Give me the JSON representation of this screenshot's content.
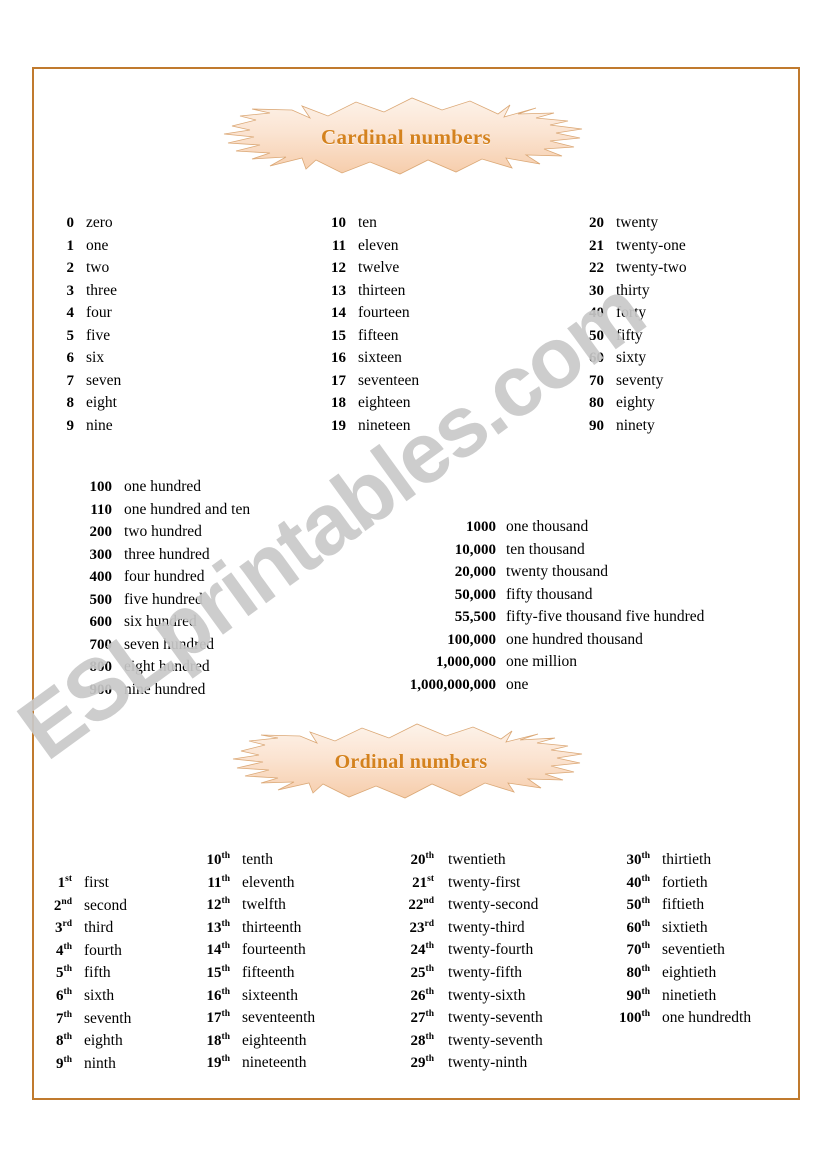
{
  "page": {
    "border_color": "#c07a2e",
    "background": "#ffffff",
    "watermark_text": "ESLprintables.com",
    "watermark_color": "#c9c9c9"
  },
  "banners": {
    "cardinal_title": "Cardinal numbers",
    "ordinal_title": "Ordinal numbers",
    "title_color": "#d4821e",
    "fill_light": "#fdf0e6",
    "fill_dark": "#f7cfae",
    "stroke": "#d9a273"
  },
  "cardinal": {
    "columns": [
      {
        "rows": [
          {
            "num": "0",
            "word": "zero"
          },
          {
            "num": "1",
            "word": "one"
          },
          {
            "num": "2",
            "word": "two"
          },
          {
            "num": "3",
            "word": "three"
          },
          {
            "num": "4",
            "word": "four"
          },
          {
            "num": "5",
            "word": "five"
          },
          {
            "num": "6",
            "word": "six"
          },
          {
            "num": "7",
            "word": "seven"
          },
          {
            "num": "8",
            "word": "eight"
          },
          {
            "num": "9",
            "word": "nine"
          }
        ]
      },
      {
        "rows": [
          {
            "num": "10",
            "word": "ten"
          },
          {
            "num": "11",
            "word": "eleven"
          },
          {
            "num": "12",
            "word": "twelve"
          },
          {
            "num": "13",
            "word": "thirteen"
          },
          {
            "num": "14",
            "word": "fourteen"
          },
          {
            "num": "15",
            "word": "fifteen"
          },
          {
            "num": "16",
            "word": "sixteen"
          },
          {
            "num": "17",
            "word": "seventeen"
          },
          {
            "num": "18",
            "word": "eighteen"
          },
          {
            "num": "19",
            "word": "nineteen"
          }
        ]
      },
      {
        "rows": [
          {
            "num": "20",
            "word": "twenty"
          },
          {
            "num": "21",
            "word": "twenty-one"
          },
          {
            "num": "22",
            "word": "twenty-two"
          },
          {
            "num": "30",
            "word": "thirty"
          },
          {
            "num": "40",
            "word": "forty"
          },
          {
            "num": "50",
            "word": "fifty"
          },
          {
            "num": "60",
            "word": "sixty"
          },
          {
            "num": "70",
            "word": "seventy"
          },
          {
            "num": "80",
            "word": "eighty"
          },
          {
            "num": "90",
            "word": "ninety"
          }
        ]
      }
    ]
  },
  "hundreds": {
    "rows": [
      {
        "num": "100",
        "word": "one hundred"
      },
      {
        "num": "110",
        "word": "one hundred and ten"
      },
      {
        "num": "200",
        "word": "two hundred"
      },
      {
        "num": "300",
        "word": "three hundred"
      },
      {
        "num": "400",
        "word": "four hundred"
      },
      {
        "num": "500",
        "word": "five hundred"
      },
      {
        "num": "600",
        "word": "six hundred"
      },
      {
        "num": "700",
        "word": "seven hundred"
      },
      {
        "num": "800",
        "word": "eight hundred"
      },
      {
        "num": "900",
        "word": "nine hundred"
      }
    ]
  },
  "thousands": {
    "rows": [
      {
        "num": "1000",
        "word": "one thousand"
      },
      {
        "num": "10,000",
        "word": "ten thousand"
      },
      {
        "num": "20,000",
        "word": "twenty thousand"
      },
      {
        "num": "50,000",
        "word": "fifty thousand"
      },
      {
        "num": "55,500",
        "word": "fifty-five thousand five hundred"
      },
      {
        "num": "100,000",
        "word": "one hundred thousand"
      },
      {
        "num": "1,000,000",
        "word": "one million"
      },
      {
        "num": "1,000,000,000",
        "word": "one"
      }
    ]
  },
  "ordinal": {
    "columns": [
      {
        "rows": [
          {
            "num": "1",
            "suffix": "st",
            "word": "first"
          },
          {
            "num": "2",
            "suffix": "nd",
            "word": "second"
          },
          {
            "num": "3",
            "suffix": "rd",
            "word": "third"
          },
          {
            "num": "4",
            "suffix": "th",
            "word": "fourth"
          },
          {
            "num": "5",
            "suffix": "th",
            "word": "fifth"
          },
          {
            "num": "6",
            "suffix": "th",
            "word": "sixth"
          },
          {
            "num": "7",
            "suffix": "th",
            "word": "seventh"
          },
          {
            "num": "8",
            "suffix": "th",
            "word": "eighth"
          },
          {
            "num": "9",
            "suffix": "th",
            "word": "ninth"
          }
        ]
      },
      {
        "rows": [
          {
            "num": "10",
            "suffix": "th",
            "word": "tenth"
          },
          {
            "num": "11",
            "suffix": "th",
            "word": "eleventh"
          },
          {
            "num": "12",
            "suffix": "th",
            "word": "twelfth"
          },
          {
            "num": "13",
            "suffix": "th",
            "word": "thirteenth"
          },
          {
            "num": "14",
            "suffix": "th",
            "word": "fourteenth"
          },
          {
            "num": "15",
            "suffix": "th",
            "word": "fifteenth"
          },
          {
            "num": "16",
            "suffix": "th",
            "word": "sixteenth"
          },
          {
            "num": "17",
            "suffix": "th",
            "word": "seventeenth"
          },
          {
            "num": "18",
            "suffix": "th",
            "word": "eighteenth"
          },
          {
            "num": "19",
            "suffix": "th",
            "word": "nineteenth"
          }
        ]
      },
      {
        "rows": [
          {
            "num": "20",
            "suffix": "th",
            "word": "twentieth"
          },
          {
            "num": "21",
            "suffix": "st",
            "word": "twenty-first"
          },
          {
            "num": "22",
            "suffix": "nd",
            "word": "twenty-second"
          },
          {
            "num": "23",
            "suffix": "rd",
            "word": "twenty-third"
          },
          {
            "num": "24",
            "suffix": "th",
            "word": "twenty-fourth"
          },
          {
            "num": "25",
            "suffix": "th",
            "word": "twenty-fifth"
          },
          {
            "num": "26",
            "suffix": "th",
            "word": "twenty-sixth"
          },
          {
            "num": "27",
            "suffix": "th",
            "word": "twenty-seventh"
          },
          {
            "num": "28",
            "suffix": "th",
            "word": "twenty-seventh"
          },
          {
            "num": "29",
            "suffix": "th",
            "word": "twenty-ninth"
          }
        ]
      },
      {
        "rows": [
          {
            "num": "30",
            "suffix": "th",
            "word": "thirtieth"
          },
          {
            "num": "40",
            "suffix": "th",
            "word": "fortieth"
          },
          {
            "num": "50",
            "suffix": "th",
            "word": "fiftieth"
          },
          {
            "num": "60",
            "suffix": "th",
            "word": "sixtieth"
          },
          {
            "num": "70",
            "suffix": "th",
            "word": "seventieth"
          },
          {
            "num": "80",
            "suffix": "th",
            "word": "eightieth"
          },
          {
            "num": "90",
            "suffix": "th",
            "word": "ninetieth"
          },
          {
            "num": "100",
            "suffix": "th",
            "word": "one hundredth"
          }
        ]
      }
    ]
  }
}
